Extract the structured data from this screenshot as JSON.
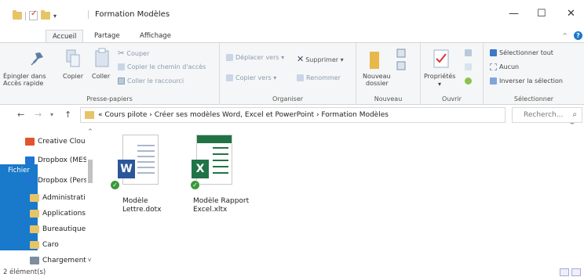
{
  "window": {
    "title": "Formation Modèles",
    "minimize": "—",
    "maximize": "☐",
    "close": "✕"
  },
  "ribbon_tabs": [
    "Fichier",
    "Accueil",
    "Partage",
    "Affichage"
  ],
  "ribbon": {
    "presse_papiers": {
      "label": "Presse-papiers",
      "pin_label_1": "Épingler dans",
      "pin_label_2": "Accès rapide",
      "copy": "Copier",
      "paste": "Coller",
      "cut": "Couper",
      "copy_path": "Copier le chemin d'accès",
      "paste_shortcut": "Coller le raccourci"
    },
    "organiser": {
      "label": "Organiser",
      "move_to": "Déplacer vers",
      "copy_to": "Copier vers",
      "delete": "Supprimer",
      "rename": "Renommer"
    },
    "nouveau": {
      "label": "Nouveau",
      "new_folder_1": "Nouveau",
      "new_folder_2": "dossier"
    },
    "ouvrir": {
      "label": "Ouvrir",
      "properties": "Propriétés"
    },
    "selectionner": {
      "label": "Sélectionner",
      "select_all": "Sélectionner tout",
      "none": "Aucun",
      "invert": "Inverser la sélection"
    }
  },
  "address": {
    "prefix": "«",
    "path": "Cours pilote  ›  Créer ses modèles Word, Excel et PowerPoint  ›  Formation Modèles",
    "search_placeholder": "Recherch..."
  },
  "nav_pane": [
    {
      "label": "Creative Clou",
      "icon": "creative-cloud-icon",
      "color": "#e0552b"
    },
    {
      "label": "Dropbox (MES",
      "icon": "dropbox-icon",
      "color": "#1f74d4"
    },
    {
      "label": "Dropbox (Pers",
      "icon": "dropbox-icon",
      "color": "#1f74d4"
    },
    {
      "label": "Administrati",
      "icon": "folder-icon",
      "color": "#e8c468"
    },
    {
      "label": "Applications",
      "icon": "folder-icon",
      "color": "#e8c468"
    },
    {
      "label": "Bureautique",
      "icon": "folder-icon",
      "color": "#e8c468"
    },
    {
      "label": "Caro",
      "icon": "folder-icon",
      "color": "#e8c468"
    },
    {
      "label": "Chargement",
      "icon": "folder-icon",
      "color": "#7d8c9e"
    }
  ],
  "files": [
    {
      "name_1": "Modèle",
      "name_2": "Lettre.dotx",
      "type": "word",
      "color": "#2b579a",
      "letter": "W"
    },
    {
      "name_1": "Modèle Rapport",
      "name_2": "Excel.xltx",
      "type": "excel",
      "color": "#217346",
      "letter": "X"
    }
  ],
  "status": {
    "count": "2 élément(s)"
  }
}
